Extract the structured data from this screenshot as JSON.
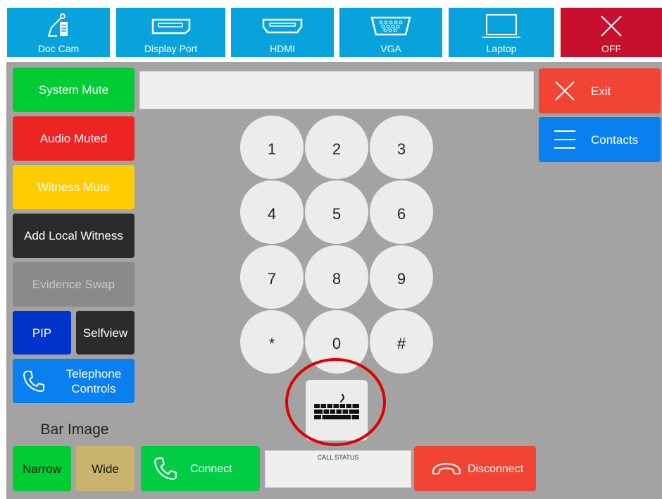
{
  "sources": [
    {
      "label": "Doc Cam",
      "icon": "doc-cam-icon"
    },
    {
      "label": "Display Port",
      "icon": "display-port-icon"
    },
    {
      "label": "HDMI",
      "icon": "hdmi-icon"
    },
    {
      "label": "VGA",
      "icon": "vga-icon"
    },
    {
      "label": "Laptop",
      "icon": "laptop-icon"
    },
    {
      "label": "OFF",
      "icon": "close-icon"
    }
  ],
  "left_controls": {
    "system_mute": "System Mute",
    "audio_muted": "Audio Muted",
    "witness_mute": "Witness Mute",
    "add_local_witness": "Add Local Witness",
    "evidence_swap": "Evidence Swap",
    "pip": "PIP",
    "selfview": "Selfview",
    "telephone_controls": "Telephone Controls"
  },
  "bar_image": {
    "title": "Bar Image",
    "narrow": "Narrow",
    "wide": "Wide"
  },
  "right_controls": {
    "exit": "Exit",
    "contacts": "Contacts"
  },
  "dial_input": {
    "value": ""
  },
  "keypad": [
    "1",
    "2",
    "3",
    "4",
    "5",
    "6",
    "7",
    "8",
    "9",
    "*",
    "0",
    "#"
  ],
  "call": {
    "connect": "Connect",
    "status_label": "CALL STATUS",
    "status_value": "",
    "disconnect": "Disconnect"
  },
  "colors": {
    "source_blue": "#08a2dc",
    "off_red": "#c8102e",
    "green": "#00cc33",
    "red": "#ee2424",
    "yellow": "#ffcc00",
    "dark": "#2b2b2b",
    "disabled_gray": "#8a8a8a",
    "pip_blue": "#0033cc",
    "tel_blue": "#0a7ff0",
    "exit_red": "#f24434",
    "khaki": "#c8b46a",
    "highlight_ring": "#e00000"
  }
}
